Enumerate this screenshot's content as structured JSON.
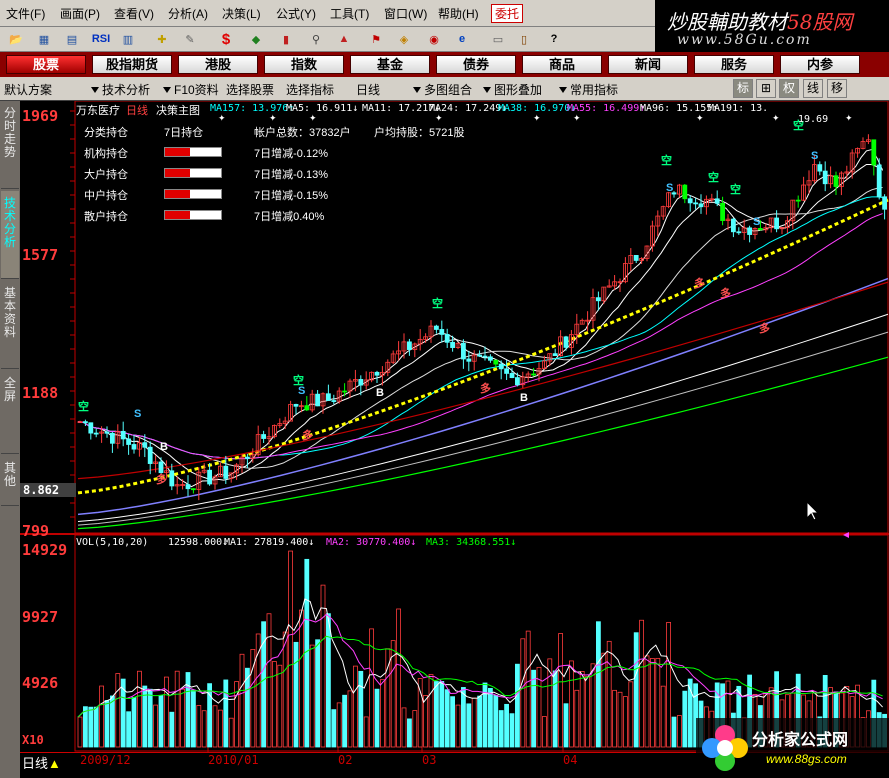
{
  "menu": {
    "items": [
      "文件(F)",
      "画面(P)",
      "查看(V)",
      "分析(A)",
      "决策(L)",
      "公式(Y)",
      "工具(T)",
      "窗口(W)",
      "帮助(H)",
      "委托"
    ]
  },
  "brand": {
    "line1_a": "炒股輔助教材",
    "line1_b": "58股网",
    "line2": "www.58Gu.com"
  },
  "toolbar": {
    "icons": [
      "open-icon",
      "layout-icon",
      "chart-icon",
      "rsi-icon",
      "grid-icon",
      "crosshair-icon",
      "pen-icon",
      "dollar-icon",
      "flag-icon",
      "bars-icon",
      "binoculars-icon",
      "chart2-icon",
      "alert-icon",
      "diamond-icon",
      "eye-icon",
      "ie-icon",
      "doc-icon",
      "books-icon",
      "help-icon"
    ],
    "rsi_label": "RSI",
    "dollar_label": "$"
  },
  "nav": {
    "items": [
      "股票",
      "股指期货",
      "港股",
      "指数",
      "基金",
      "债券",
      "商品",
      "新闻",
      "服务",
      "内参"
    ],
    "active": 0
  },
  "subbar": {
    "items": [
      "默认方案",
      "技术分析",
      "F10资料",
      "选择股票",
      "选择指标",
      "日线",
      "多图组合",
      "图形叠加",
      "常用指标"
    ],
    "right_buttons": [
      "标",
      "⊞",
      "权",
      "线",
      "移"
    ]
  },
  "sidebar": {
    "tabs": [
      "分时走势",
      "技术分析",
      "基本资料",
      "全屏",
      "其他"
    ],
    "active": 1
  },
  "stock": {
    "name": "万东医疗",
    "period": "日线",
    "main_chart": "决策主图"
  },
  "ma_legend": [
    {
      "label": "MA157: 13.976↑",
      "color": "#00ffff"
    },
    {
      "label": "MA5: 16.911↓",
      "color": "#ffffff"
    },
    {
      "label": "MA11: 17.217↓",
      "color": "#ffffff"
    },
    {
      "label": "MA24: 17.249↓",
      "color": "#ffffff"
    },
    {
      "label": "MA38: 16.970↓",
      "color": "#00ffff"
    },
    {
      "label": "MA55: 16.499↑",
      "color": "#ff40ff"
    },
    {
      "label": "MA96: 15.155↑",
      "color": "#ffffff"
    },
    {
      "label": "MA191: 13.",
      "color": "#ffffff"
    }
  ],
  "holdings": {
    "header": {
      "c1": "分类持仓",
      "c2": "7日持仓",
      "c3": "帐户总数：37832户",
      "c4": "户均持股：5721股"
    },
    "rows": [
      {
        "label": "机构持仓",
        "fill": 0.45,
        "change": "7日增减-0.12%"
      },
      {
        "label": "大户持仓",
        "fill": 0.45,
        "change": "7日增减-0.13%"
      },
      {
        "label": "中户持仓",
        "fill": 0.45,
        "change": "7日增减-0.15%"
      },
      {
        "label": "散户持仓",
        "fill": 0.45,
        "change": "7日增减0.40%"
      }
    ]
  },
  "price_axis": {
    "labels": [
      "1969",
      "1577",
      "1188",
      "8.862",
      "799"
    ]
  },
  "price_marks": {
    "high": "19.69",
    "b_labels": [
      "B",
      "B",
      "B"
    ],
    "s_labels": [
      "S",
      "S",
      "S",
      "S",
      "S"
    ],
    "kong": [
      "空",
      "空",
      "空",
      "空",
      "空",
      "空",
      "空"
    ],
    "duo": [
      "多",
      "多",
      "多",
      "多",
      "多",
      "多"
    ]
  },
  "volume_legend": [
    {
      "label": "VOL(5,10,20)",
      "color": "#ffffff"
    },
    {
      "label": "12598.000↓",
      "color": "#ffffff"
    },
    {
      "label": "MA1: 27819.400↓",
      "color": "#ffffff"
    },
    {
      "label": "MA2: 30770.400↓",
      "color": "#ff40ff"
    },
    {
      "label": "MA3: 34368.551↓",
      "color": "#00ff00"
    }
  ],
  "volume_axis": {
    "labels": [
      "14929",
      "9927",
      "4926",
      "X10"
    ]
  },
  "bottom": {
    "period_label": "日线",
    "dates": [
      "2009/12",
      "2010/01",
      "02",
      "03",
      "04"
    ]
  },
  "colors": {
    "up": "#ff3c3c",
    "down": "#54ffff",
    "bg": "#000000",
    "accent": "#c00000"
  },
  "chart_data": {
    "type": "candlestick",
    "ylim": [
      7.99,
      19.69
    ],
    "volume_ylim": [
      0,
      14929
    ],
    "x_labels": [
      "2009/12",
      "2010/01",
      "02",
      "03",
      "04"
    ]
  }
}
